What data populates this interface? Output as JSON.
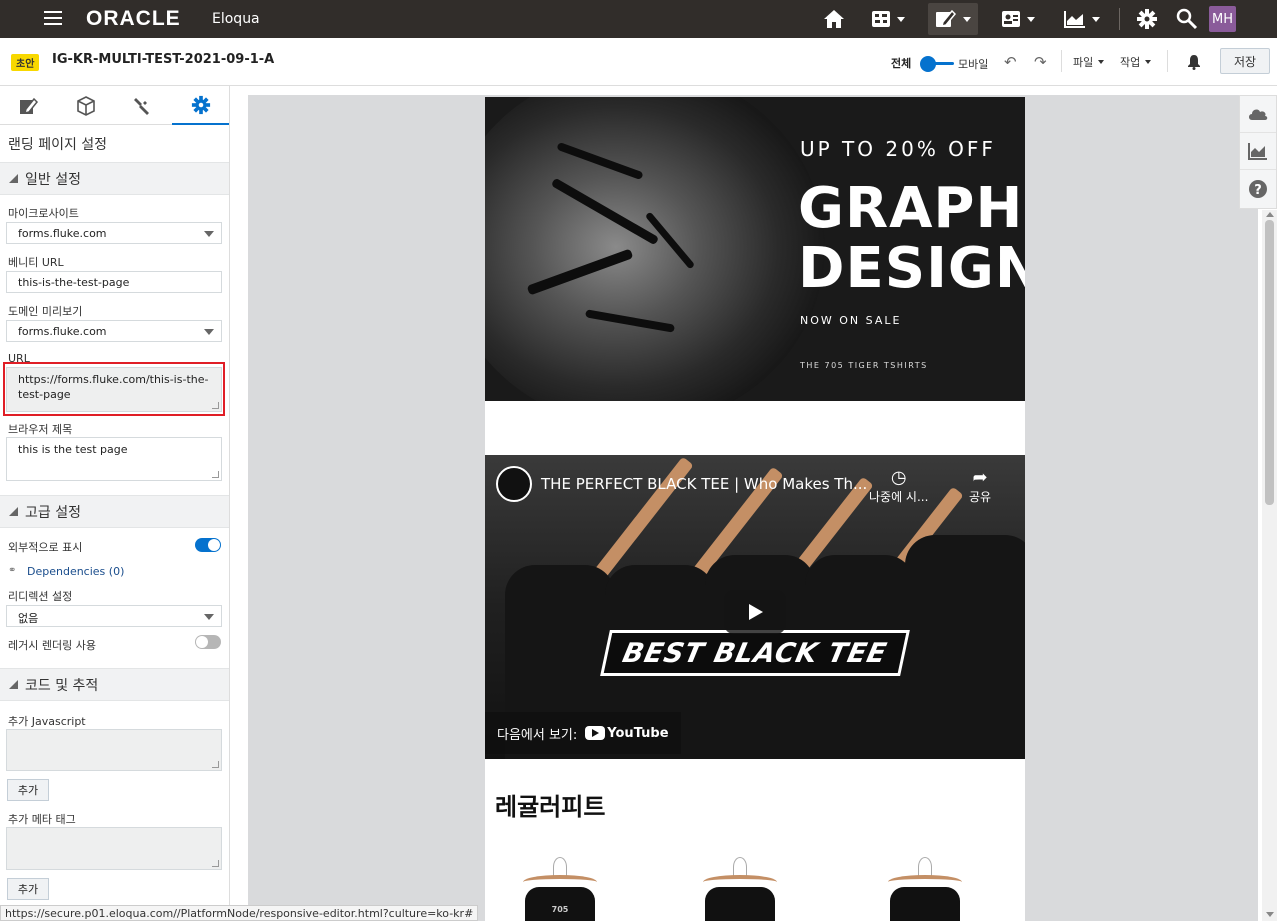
{
  "topbar": {
    "brand": "ORACLE",
    "product": "Eloqua",
    "avatar": "MH",
    "icons": [
      "menu-icon",
      "home-icon",
      "assets-icon",
      "campaigns-icon",
      "contacts-icon",
      "analytics-icon",
      "settings-icon",
      "search-icon"
    ]
  },
  "toolbar": {
    "status_badge": "초안",
    "doc_title": "IG-KR-MULTI-TEST-2021-09-1-A",
    "view_full": "전체",
    "view_mobile": "모바일",
    "file_menu": "파일",
    "actions_menu": "작업",
    "save": "저장"
  },
  "sidebar": {
    "panel_title": "랜딩 페이지 설정",
    "general": {
      "heading": "일반 설정",
      "microsite_label": "마이크로사이트",
      "microsite_value": "forms.fluke.com",
      "vanity_label": "베니티 URL",
      "vanity_value": "this-is-the-test-page",
      "domain_label": "도메인 미리보기",
      "domain_value": "forms.fluke.com",
      "url_label": "URL",
      "url_value": "https://forms.fluke.com/this-is-the-test-page",
      "browser_title_label": "브라우저 제목",
      "browser_title_value": "this is the test page"
    },
    "advanced": {
      "heading": "고급 설정",
      "external_label": "외부적으로 표시",
      "external_on": true,
      "dependencies": "Dependencies (0)",
      "redirect_label": "리디렉션 설정",
      "redirect_value": "없음",
      "legacy_label": "레거시 렌더링 사용",
      "legacy_on": false
    },
    "code": {
      "heading": "코드 및 추적",
      "js_label": "추가 Javascript",
      "js_add": "추가",
      "meta_label": "추가 메타 태그",
      "meta_add": "추가"
    }
  },
  "canvas": {
    "hero": {
      "subtitle": "UP TO 20% OFF",
      "title_line1": "GRAPHIC",
      "title_line2": "DESIGN",
      "sale": "NOW ON SALE",
      "small": "THE 705 TIGER TSHIRTS"
    },
    "video": {
      "title": "THE PERFECT BLACK TEE | Who Makes Th...",
      "watch_later": "나중에 시...",
      "share": "공유",
      "overlay_text": "BEST BLACK TEE",
      "watch_on": "다음에서 보기:",
      "youtube": "YouTube"
    },
    "regular_heading": "레귤러피트",
    "product_labels": [
      "705",
      "",
      ""
    ]
  },
  "status_url": "https://secure.p01.eloqua.com//PlatformNode/responsive-editor.html?culture=ko-kr#",
  "colors": {
    "topbar": "#312d2a",
    "accent": "#0572ce",
    "badge": "#f8d800",
    "highlight": "#e01e26"
  }
}
